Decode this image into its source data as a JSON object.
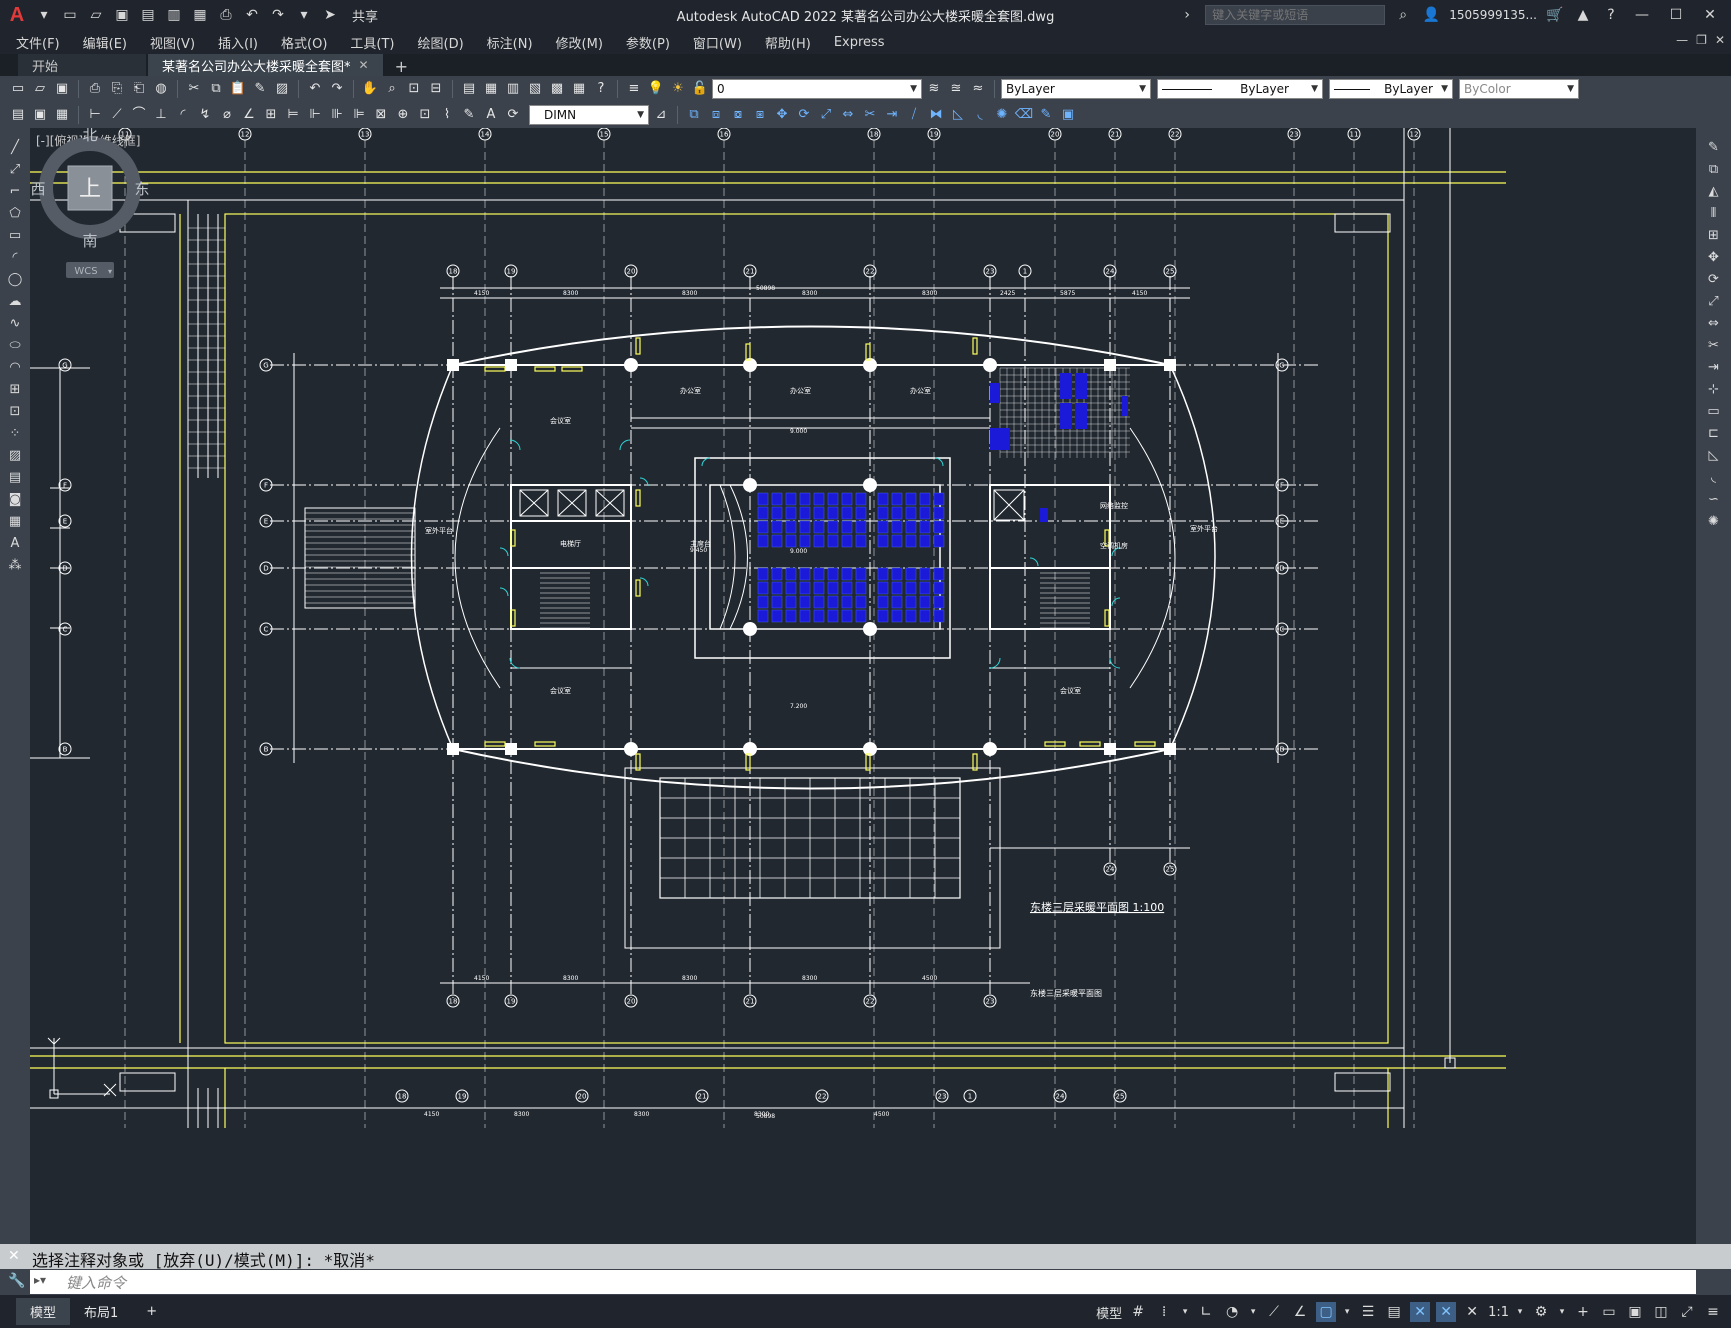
{
  "app": {
    "title": "Autodesk AutoCAD 2022    某著名公司办公大楼采暖全套图.dwg",
    "share_label": "共享",
    "search_placeholder": "键入关键字或短语",
    "user_label": "1505999135...",
    "logo": "A"
  },
  "menu": [
    "文件(F)",
    "编辑(E)",
    "视图(V)",
    "插入(I)",
    "格式(O)",
    "工具(T)",
    "绘图(D)",
    "标注(N)",
    "修改(M)",
    "参数(P)",
    "窗口(W)",
    "帮助(H)",
    "Express"
  ],
  "tabs": [
    {
      "label": "开始",
      "active": false
    },
    {
      "label": "某著名公司办公大楼采暖全套图*",
      "active": true
    }
  ],
  "properties": {
    "layer": "0",
    "color": "ByLayer",
    "linetype": "ByLayer",
    "lineweight": "ByLayer",
    "plotstyle": "ByColor",
    "dimstyle": "DIMN"
  },
  "viewport": {
    "label": "[-][俯视][二维线框]"
  },
  "viewcube": {
    "north": "北",
    "south": "南",
    "east": "东",
    "west": "西",
    "top": "上",
    "wcs": "WCS"
  },
  "drawing": {
    "title": "东楼三层采暖平面图 1:100",
    "subtitle": "东楼三层采暖平面图",
    "grid_top": [
      "11",
      "12",
      "13",
      "14",
      "15",
      "16",
      "18",
      "19",
      "20",
      "21",
      "22",
      "23"
    ],
    "plan_cols": [
      "18",
      "19",
      "20",
      "21",
      "22",
      "23",
      "1",
      "24",
      "25"
    ],
    "plan_rows": [
      "G",
      "F",
      "E",
      "D",
      "C",
      "B"
    ],
    "dim_total": "50898",
    "dims_top": [
      "4150",
      "8300",
      "8300",
      "8300",
      "8300",
      "2425",
      "5875",
      "4150"
    ],
    "dims_bottom": [
      "4150",
      "8300",
      "8300",
      "8300",
      "4500"
    ],
    "rooms": [
      "办公室",
      "办公室",
      "办公室",
      "会议室",
      "电梯厅",
      "主席台",
      "会议室",
      "会议室",
      "空调机房",
      "网络监控",
      "室外平台",
      "室外平台"
    ],
    "levels": [
      "9.000",
      "9.000",
      "7.200",
      "9.450"
    ]
  },
  "command": {
    "history": "选择注释对象或 [放弃(U)/模式(M)]: *取消*",
    "placeholder": "键入命令"
  },
  "layouts": [
    {
      "label": "模型",
      "active": true
    },
    {
      "label": "布局1",
      "active": false
    }
  ],
  "status": {
    "model_label": "模型",
    "scale": "1:1"
  }
}
